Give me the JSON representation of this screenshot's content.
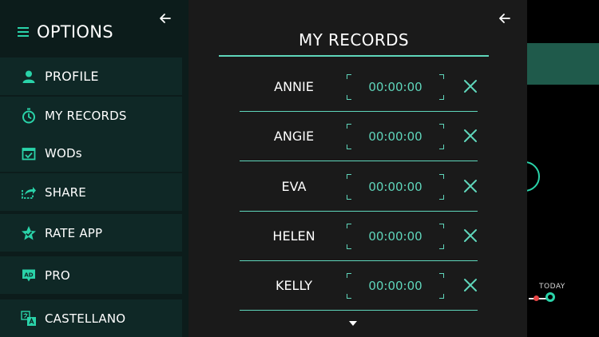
{
  "colors": {
    "accent": "#5fd6bb",
    "drawer_bg": "#0c1c1b",
    "item_bg": "#0f2826",
    "panel_bg": "#1a1a1a"
  },
  "drawer": {
    "title": "OPTIONS",
    "back_icon": "arrow-left-icon",
    "items": [
      {
        "label": "PROFILE",
        "icon": "person-icon"
      },
      {
        "label": "MY RECORDS",
        "icon": "stopwatch-icon"
      },
      {
        "label": "WODs",
        "icon": "calendar-check-icon"
      },
      {
        "label": "SHARE",
        "icon": "share-icon"
      },
      {
        "label": "RATE APP",
        "icon": "star-check-icon"
      },
      {
        "label": "PRO",
        "icon": "ad-badge-icon"
      },
      {
        "label": "CASTELLANO",
        "icon": "translate-icon"
      }
    ]
  },
  "records": {
    "title": "MY RECORDS",
    "back_icon": "arrow-left-icon",
    "rows": [
      {
        "name": "ANNIE",
        "time": "00:00:00"
      },
      {
        "name": "ANGIE",
        "time": "00:00:00"
      },
      {
        "name": "EVA",
        "time": "00:00:00"
      },
      {
        "name": "HELEN",
        "time": "00:00:00"
      },
      {
        "name": "KELLY",
        "time": "00:00:00"
      }
    ],
    "more_icon": "caret-down-icon"
  },
  "background": {
    "today_label": "TODAY"
  }
}
